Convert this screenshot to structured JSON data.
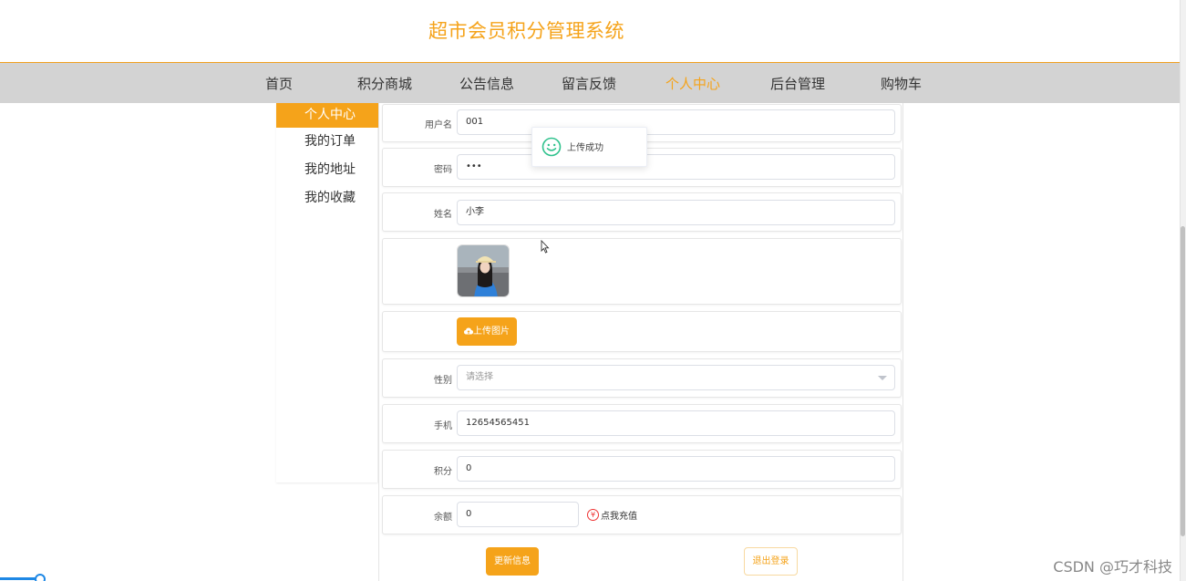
{
  "header": {
    "title": "超市会员积分管理系统"
  },
  "nav": {
    "items": [
      "首页",
      "积分商城",
      "公告信息",
      "留言反馈",
      "个人中心",
      "后台管理",
      "购物车"
    ],
    "active_index": 4
  },
  "sidebar": {
    "items": [
      "个人中心",
      "我的订单",
      "我的地址",
      "我的收藏"
    ],
    "active_index": 0
  },
  "form": {
    "username": {
      "label": "用户名",
      "value": "001"
    },
    "password": {
      "label": "密码",
      "value": "•••"
    },
    "name": {
      "label": "姓名",
      "value": "小李"
    },
    "upload_label": "上传图片",
    "gender": {
      "label": "性别",
      "placeholder": "请选择"
    },
    "phone": {
      "label": "手机",
      "value": "12654565451"
    },
    "points": {
      "label": "积分",
      "value": "0"
    },
    "balance": {
      "label": "余额",
      "value": "0",
      "recharge_label": "点我充值"
    },
    "update_button": "更新信息",
    "logout_button": "退出登录"
  },
  "toast": {
    "message": "上传成功"
  },
  "watermark": "CSDN @巧才科技",
  "colors": {
    "accent": "#f5a31a",
    "navbar": "#d3d3d3",
    "success": "#2fc28d",
    "danger": "#ee3333"
  },
  "icons": {
    "toast": "smile-icon",
    "upload": "cloud-upload-icon",
    "recharge": "yen-icon",
    "select": "chevron-down-icon",
    "cursor": "mouse-cursor-icon"
  }
}
